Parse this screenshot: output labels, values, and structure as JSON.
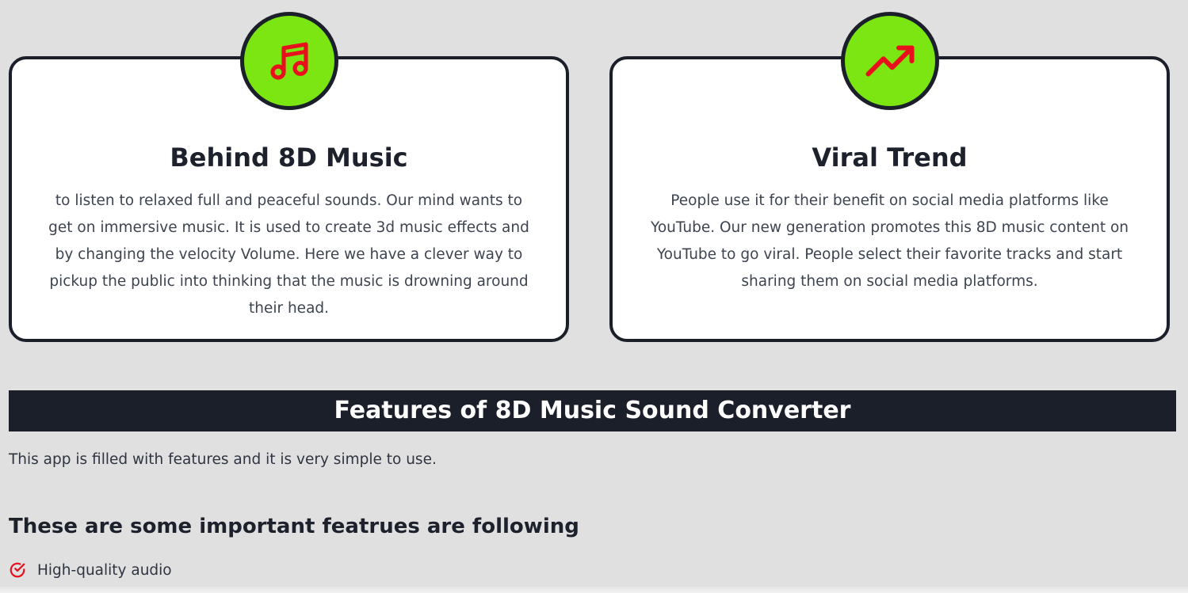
{
  "cards": [
    {
      "title": "Behind 8D Music",
      "icon": "music-note-icon",
      "text": "to listen to relaxed full and peaceful sounds. Our mind wants to get on immersive music. It is used to create 3d music effects and by changing the velocity Volume. Here we have a clever way to pickup the public into thinking that the music is drowning around their head."
    },
    {
      "title": "Viral Trend",
      "icon": "trending-up-icon",
      "text": "People use it for their benefit on social media platforms like YouTube. Our new generation promotes this 8D music content on YouTube to go viral. People select their favorite tracks and start sharing them on social media platforms."
    }
  ],
  "features": {
    "banner_title": "Features of 8D Music Sound Converter",
    "intro": "This app is filled with features and it is very simple to use.",
    "subheading": "These are some important featrues are following",
    "items": [
      {
        "label": "High-quality audio",
        "icon": "check-circle-icon"
      }
    ]
  },
  "colors": {
    "page_background": "#e1e0e1",
    "card_border": "#1b1f2a",
    "badge_green": "#7be612",
    "icon_red": "#e8101d",
    "banner_dark": "#1b1f2a"
  }
}
